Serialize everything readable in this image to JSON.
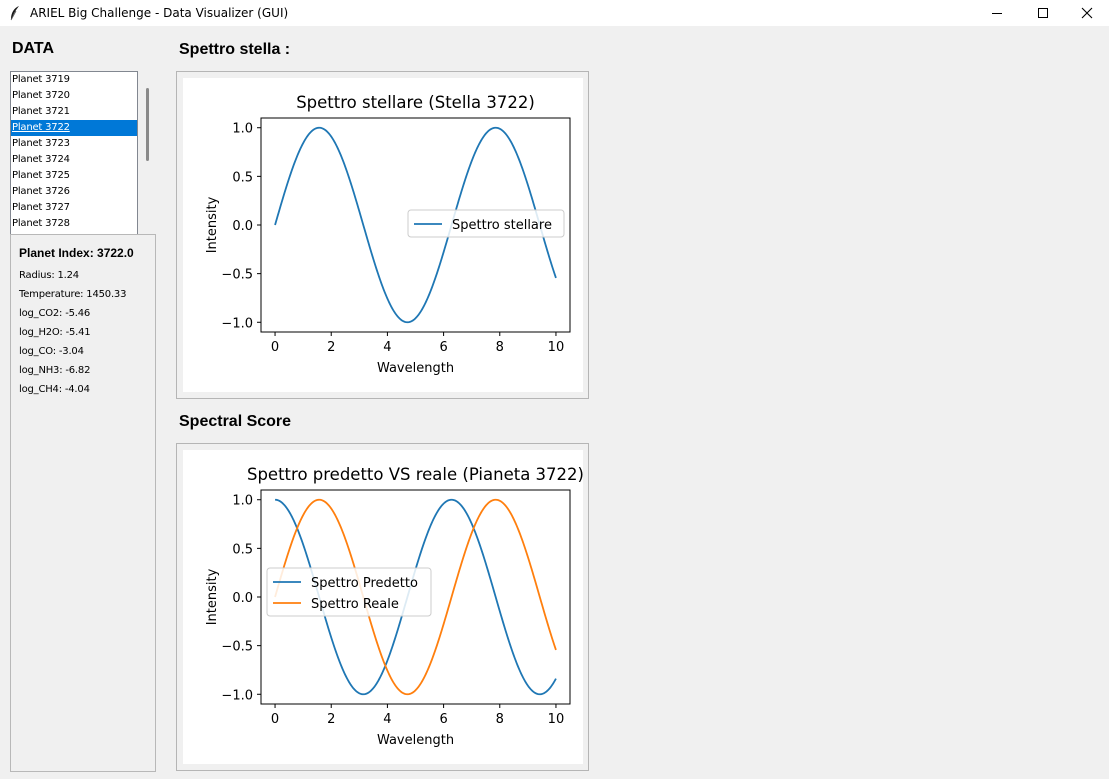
{
  "window": {
    "title": "ARIEL Big Challenge - Data Visualizer (GUI)",
    "minimize_icon": "minimize-icon",
    "maximize_icon": "maximize-icon",
    "close_icon": "close-icon"
  },
  "sidebar": {
    "heading": "DATA",
    "planets": [
      "Planet 3719",
      "Planet 3720",
      "Planet 3721",
      "Planet 3722",
      "Planet 3723",
      "Planet 3724",
      "Planet 3725",
      "Planet 3726",
      "Planet 3727",
      "Planet 3728"
    ],
    "selected_planet": "Planet 3722",
    "info": {
      "title": "Planet Index: 3722.0",
      "lines": [
        "Radius: 1.24",
        "Temperature: 1450.33",
        "log_CO2: -5.46",
        "log_H2O: -5.41",
        "log_CO: -3.04",
        "log_NH3: -6.82",
        "log_CH4: -4.04"
      ]
    }
  },
  "sections": {
    "stellar_heading": "Spettro stella :",
    "score_heading": "Spectral Score"
  },
  "colors": {
    "series1": "#1f77b4",
    "series2": "#ff7f0e",
    "selection": "#0078d7"
  },
  "chart_data": [
    {
      "type": "line",
      "title": "Spettro stellare (Stella 3722)",
      "xlabel": "Wavelength",
      "ylabel": "Intensity",
      "xlim": [
        -0.5,
        10.5
      ],
      "ylim": [
        -1.1,
        1.1
      ],
      "xticks": [
        0,
        2,
        4,
        6,
        8,
        10
      ],
      "xtick_labels": [
        "0",
        "2",
        "4",
        "6",
        "8",
        "10"
      ],
      "yticks": [
        1.0,
        0.5,
        0.0,
        -0.5,
        -1.0
      ],
      "ytick_labels": [
        "1.0",
        "0.5",
        "0.0",
        "−0.5",
        "−1.0"
      ],
      "legend_position": "center-right",
      "series": [
        {
          "name": "Spettro stellare",
          "function": "sin",
          "x_range": [
            0,
            10
          ]
        }
      ]
    },
    {
      "type": "line",
      "title": "Spettro predetto VS reale (Pianeta 3722)",
      "xlabel": "Wavelength",
      "ylabel": "Intensity",
      "xlim": [
        -0.5,
        10.5
      ],
      "ylim": [
        -1.1,
        1.1
      ],
      "xticks": [
        0,
        2,
        4,
        6,
        8,
        10
      ],
      "xtick_labels": [
        "0",
        "2",
        "4",
        "6",
        "8",
        "10"
      ],
      "yticks": [
        1.0,
        0.5,
        0.0,
        -0.5,
        -1.0
      ],
      "ytick_labels": [
        "1.0",
        "0.5",
        "0.0",
        "−0.5",
        "−1.0"
      ],
      "legend_position": "center-left",
      "series": [
        {
          "name": "Spettro Predetto",
          "function": "cos",
          "x_range": [
            0,
            10
          ]
        },
        {
          "name": "Spettro Reale",
          "function": "sin",
          "x_range": [
            0,
            10
          ]
        }
      ]
    }
  ]
}
